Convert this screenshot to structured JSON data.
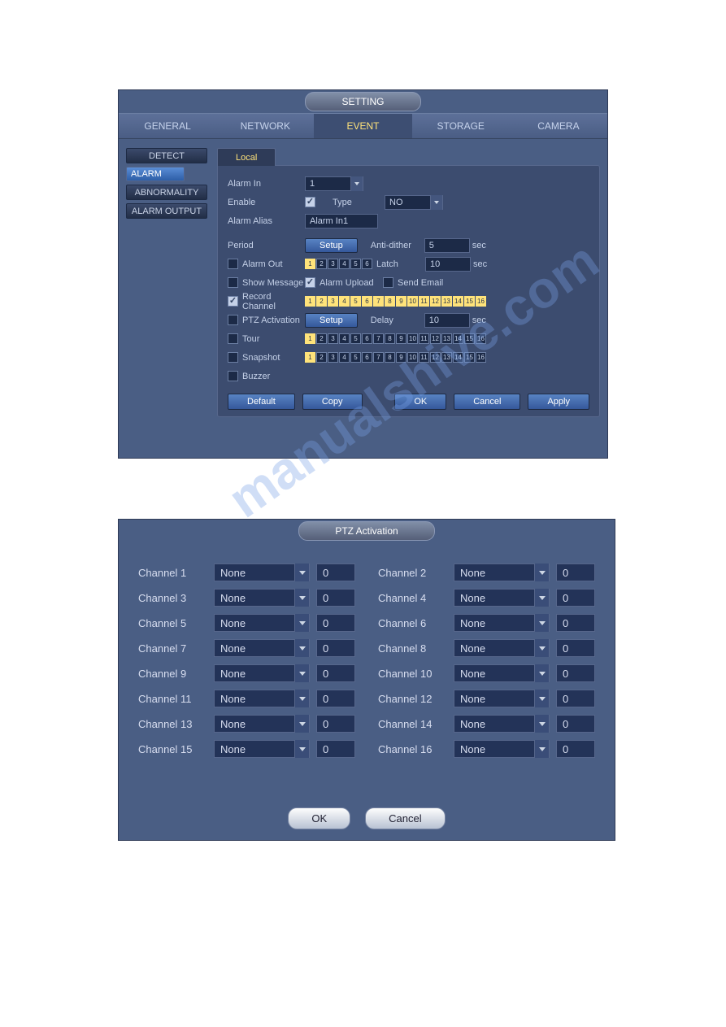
{
  "win1": {
    "title": "SETTING",
    "maintabs": [
      "GENERAL",
      "NETWORK",
      "EVENT",
      "STORAGE",
      "CAMERA"
    ],
    "maintab_active": 2,
    "sidebar": [
      "DETECT",
      "ALARM",
      "ABNORMALITY",
      "ALARM OUTPUT"
    ],
    "sidebar_active": 1,
    "subtab": "Local",
    "labels": {
      "alarm_in": "Alarm In",
      "enable": "Enable",
      "type": "Type",
      "alarm_alias": "Alarm Alias",
      "period": "Period",
      "anti_dither": "Anti-dither",
      "alarm_out": "Alarm Out",
      "latch": "Latch",
      "show_message": "Show Message",
      "alarm_upload": "Alarm Upload",
      "send_email": "Send Email",
      "record_channel": "Record Channel",
      "ptz_activation": "PTZ Activation",
      "delay": "Delay",
      "tour": "Tour",
      "snapshot": "Snapshot",
      "buzzer": "Buzzer",
      "sec": "sec",
      "setup": "Setup",
      "default": "Default",
      "copy": "Copy",
      "ok": "OK",
      "cancel": "Cancel",
      "apply": "Apply"
    },
    "values": {
      "alarm_in": "1",
      "type": "NO",
      "alias": "Alarm In1",
      "anti_dither": "5",
      "latch": "10",
      "delay": "10"
    },
    "checks": {
      "enable": true,
      "alarm_out": false,
      "show_message": false,
      "alarm_upload": true,
      "send_email": false,
      "record_channel": true,
      "ptz_activation": false,
      "tour": false,
      "snapshot": false,
      "buzzer": false
    },
    "alarm_out_ch": {
      "count": 6,
      "selected": [
        1
      ]
    },
    "record_ch": {
      "count": 16,
      "selected": [
        1,
        2,
        3,
        4,
        5,
        6,
        7,
        8,
        9,
        10,
        11,
        12,
        13,
        14,
        15,
        16
      ]
    },
    "tour_ch": {
      "count": 16,
      "selected": [
        1
      ]
    },
    "snap_ch": {
      "count": 16,
      "selected": [
        1
      ]
    }
  },
  "win2": {
    "title": "PTZ Activation",
    "channel_prefix": "Channel",
    "action_value": "None",
    "number_value": "0",
    "ok": "OK",
    "cancel": "Cancel",
    "count": 16
  },
  "watermark": "manualshive.com"
}
